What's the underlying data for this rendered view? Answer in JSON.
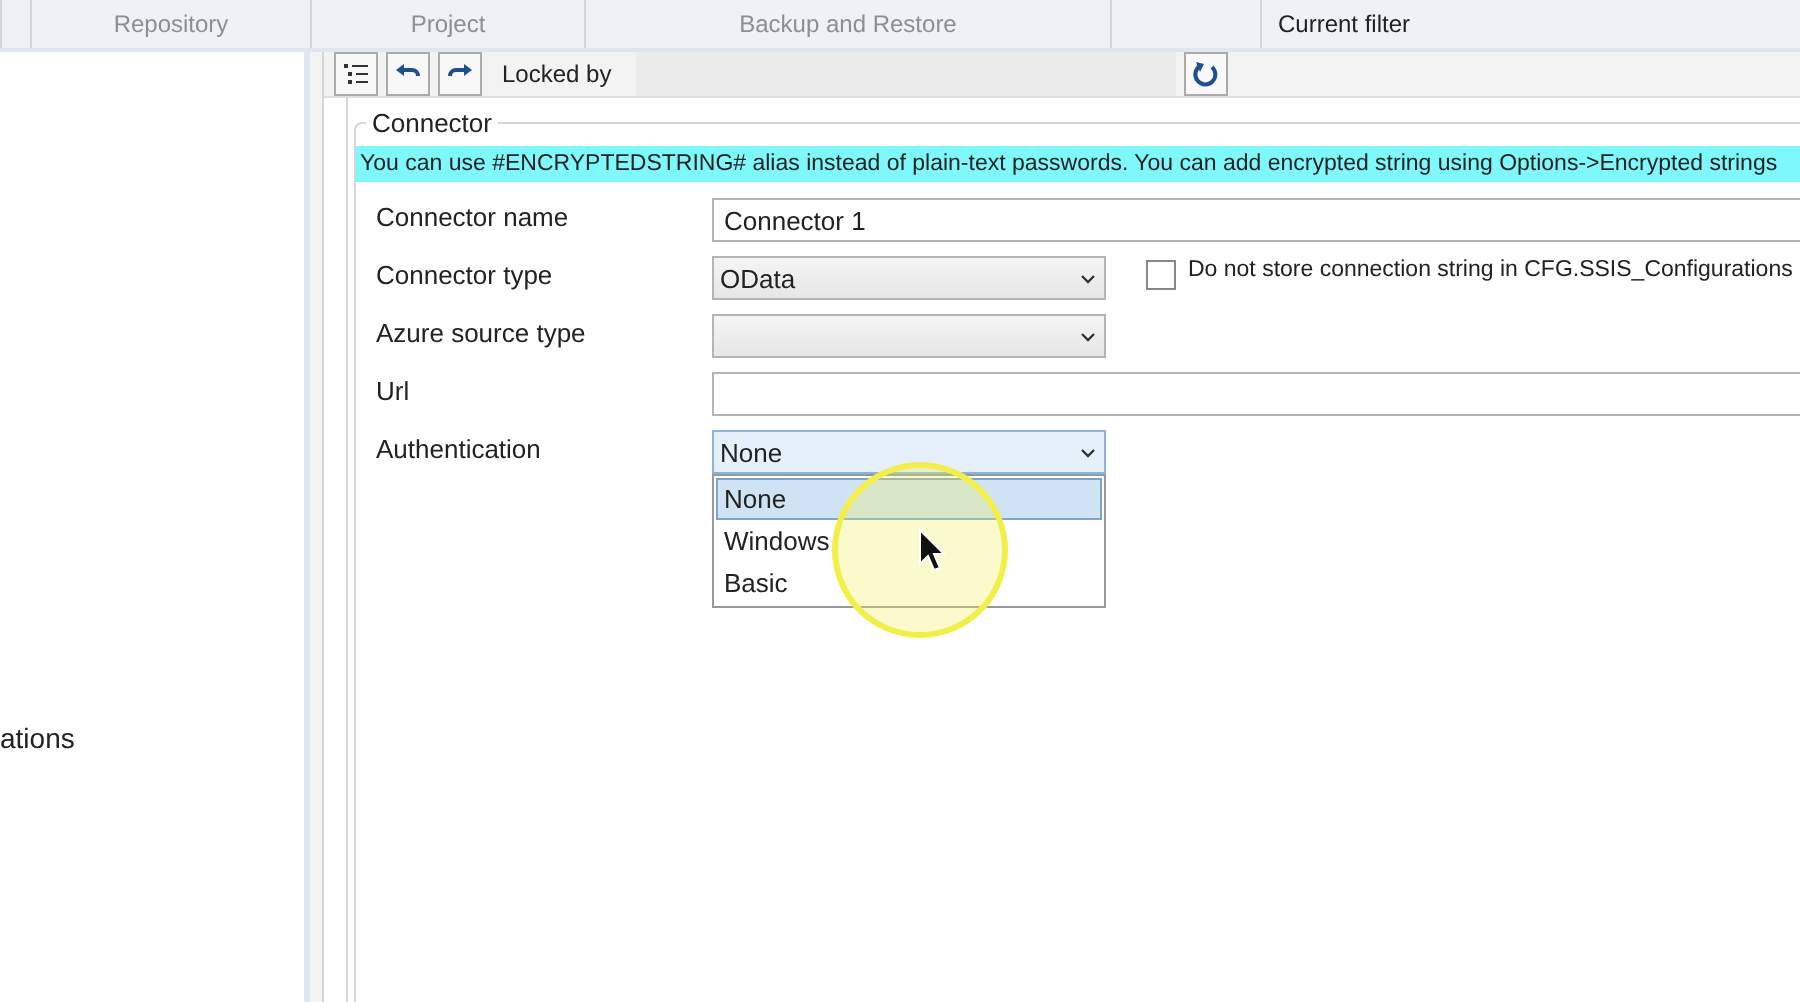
{
  "header": {
    "columns": [
      {
        "label": "Repository",
        "disabled": true
      },
      {
        "label": "Project",
        "disabled": true
      },
      {
        "label": "Backup and Restore",
        "disabled": true
      },
      {
        "label": "Current filter",
        "disabled": false
      }
    ]
  },
  "sidebar": {
    "text": "ations"
  },
  "toolbar": {
    "locked_by_label": "Locked by"
  },
  "connector": {
    "title": "Connector",
    "info": "You can use #ENCRYPTEDSTRING# alias instead of plain-text passwords. You can add encrypted string using Options->Encrypted strings",
    "fields": [
      {
        "kind": "text",
        "label": "Connector name",
        "value": "Connector 1"
      },
      {
        "kind": "select",
        "label": "Connector type",
        "value": "OData",
        "expanded": false,
        "checkbox": {
          "label": "Do not store connection string in CFG.SSIS_Configurations",
          "checked": false
        }
      },
      {
        "kind": "select",
        "label": "Azure source type",
        "expanded": false
      },
      {
        "kind": "text",
        "label": "Url"
      },
      {
        "kind": "select",
        "label": "Authentication",
        "value": "None",
        "expanded": true,
        "options": [
          {
            "label": "None",
            "selected": true
          },
          {
            "label": "Windows",
            "selected": false
          },
          {
            "label": "Basic",
            "selected": false
          }
        ]
      }
    ]
  }
}
